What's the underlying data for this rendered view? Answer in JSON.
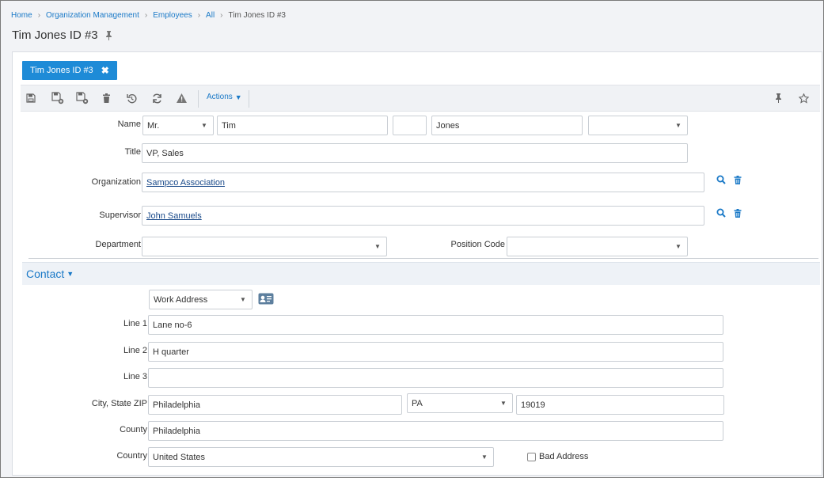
{
  "breadcrumb": {
    "items": [
      "Home",
      "Organization Management",
      "Employees",
      "All"
    ],
    "current": "Tim Jones ID #3"
  },
  "page": {
    "title": "Tim Jones ID #3"
  },
  "tab": {
    "label": "Tim Jones ID #3"
  },
  "toolbar": {
    "actions_label": "Actions"
  },
  "form": {
    "name_label": "Name",
    "prefix": "Mr.",
    "first_name": "Tim",
    "middle_name": "",
    "last_name": "Jones",
    "suffix": "",
    "title_label": "Title",
    "title_value": "VP, Sales",
    "organization_label": "Organization",
    "organization_value": "Sampco Association",
    "supervisor_label": "Supervisor",
    "supervisor_value": "John Samuels",
    "department_label": "Department",
    "department_value": "",
    "position_code_label": "Position Code",
    "position_code_value": ""
  },
  "contact": {
    "section_title": "Contact",
    "address_type": "Work Address",
    "line1_label": "Line 1",
    "line1_value": "Lane no-6",
    "line2_label": "Line 2",
    "line2_value": "H quarter",
    "line3_label": "Line 3",
    "line3_value": "",
    "city_state_zip_label": "City, State ZIP",
    "city_value": "Philadelphia",
    "state_value": "PA",
    "zip_value": "19019",
    "county_label": "County",
    "county_value": "Philadelphia",
    "country_label": "Country",
    "country_value": "United States",
    "bad_address_label": "Bad Address",
    "bad_address_checked": false
  },
  "colors": {
    "accent": "#1e8bd7",
    "link": "#1a79c7",
    "background": "#f2f3f6"
  }
}
